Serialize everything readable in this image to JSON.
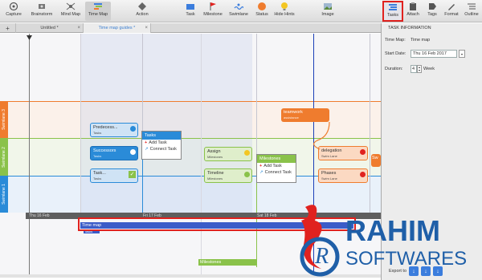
{
  "toolbar": {
    "items": [
      {
        "label": "Capture",
        "icon": "capture-icon"
      },
      {
        "label": "Brainstorm",
        "icon": "brainstorm-icon"
      },
      {
        "label": "Mind Map",
        "icon": "mind-map-icon"
      },
      {
        "label": "Time Map",
        "icon": "time-map-icon"
      },
      {
        "label": "Action",
        "icon": "action-icon"
      },
      {
        "label": "Task",
        "icon": "task-icon"
      },
      {
        "label": "Milestone",
        "icon": "milestone-icon"
      },
      {
        "label": "Swimlane",
        "icon": "swimlane-icon"
      },
      {
        "label": "Status",
        "icon": "status-icon"
      },
      {
        "label": "Hide Hints",
        "icon": "hide-hints-icon"
      },
      {
        "label": "Image",
        "icon": "image-icon"
      },
      {
        "label": "Tasks",
        "icon": "tasks-icon"
      },
      {
        "label": "Attach",
        "icon": "attach-icon"
      },
      {
        "label": "Tags",
        "icon": "tags-icon"
      },
      {
        "label": "Format",
        "icon": "format-icon"
      },
      {
        "label": "Outline",
        "icon": "outline-icon"
      }
    ]
  },
  "tabs": [
    {
      "label": "Untitled *"
    },
    {
      "label": "Time map guides *"
    }
  ],
  "add_tab": "+",
  "swimlanes": [
    {
      "label": "Swimlane 3",
      "color": "#ef7c2e"
    },
    {
      "label": "Swimlane 2",
      "color": "#8ac24a"
    },
    {
      "label": "Swimlane 1",
      "color": "#2a8bd8"
    }
  ],
  "nodes": {
    "predecessors": {
      "title": "Predecess...",
      "sub": "Tasks"
    },
    "successors": {
      "title": "Successors",
      "sub": "Tasks"
    },
    "task": {
      "title": "Task...",
      "sub": "Tasks"
    },
    "assign": {
      "title": "Assign",
      "sub": "Milestones"
    },
    "timeline": {
      "title": "Timeline",
      "sub": "Milestones"
    },
    "teamwork": {
      "title": "teamwork",
      "sub": "assistance"
    },
    "delegation": {
      "title": "delegation",
      "sub": "Swim Lane"
    },
    "phases": {
      "title": "Phases",
      "sub": "Swim Lane"
    },
    "sw_partial": {
      "title": "Sw"
    }
  },
  "popups": {
    "tasks": {
      "header": "Tasks",
      "add": "Add Task",
      "connect": "Connect Task"
    },
    "milestones": {
      "header": "Milestones",
      "add": "Add Task",
      "connect": "Connect Task"
    }
  },
  "timescale": [
    "Thu 16 Feb",
    "Fri 17 Feb",
    "Sat 18 Feb"
  ],
  "timemap_bar": {
    "label": "Time map",
    "sub": "Tasks"
  },
  "milestones_bar": {
    "label": "Milestones"
  },
  "panel": {
    "title": "TASK INFORMATION",
    "time_map_label": "Time Map:",
    "time_map_value": "Time map",
    "start_date_label": "Start Date:",
    "start_date_value": "Thu 16 Feb 2017",
    "duration_label": "Duration:",
    "duration_value": "4",
    "duration_unit": "Week",
    "export_label": "Export to"
  },
  "watermark": {
    "line1": "RAHIM",
    "line2": "SOFTWARES"
  },
  "colors": {
    "highlight": "#e0221f",
    "accent_blue": "#2a8bd8",
    "lane_orange": "#ef7c2e",
    "lane_green": "#8ac24a"
  }
}
